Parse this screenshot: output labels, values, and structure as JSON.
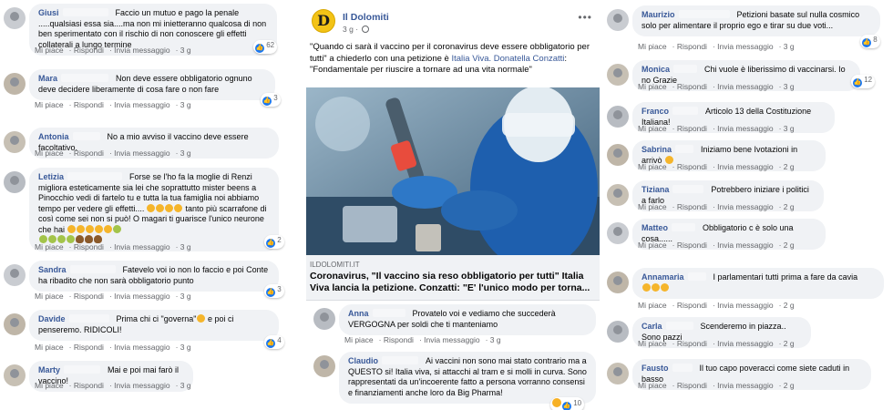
{
  "left": {
    "comments": [
      {
        "name": "Giusi",
        "text": "Faccio un mutuo e pago la penale .....qualsiasi essa sia....ma non mi inietteranno qualcosa di non ben sperimentato con il rischio di non conoscere gli effetti collaterali a lungo termine",
        "likes": "62"
      },
      {
        "name": "Mara",
        "text": "Non deve essere obbligatorio ognuno deve decidere liberamente di cosa fare o non fare",
        "likes": "3"
      },
      {
        "name": "Antonia",
        "text": "No a mio avviso il vaccino deve essere facoltativo."
      },
      {
        "name": "Letizia",
        "text": "Forse se l'ho fa la moglie di Renzi migliora esteticamente sia lei che soprattutto mister beens a Pinocchio vedi di fartelo tu e tutta la tua famiglia noi abbiamo tempo per vedere gli effetti....",
        "text2": "tanto più scarrafone di così come sei non si può! O magari ti guarisce l'unico neurone che hai",
        "likes": "2"
      },
      {
        "name": "Sandra",
        "text": "Fatevelo voi io non lo faccio e poi Conte ha ribadito che non sarà obbligatorio punto",
        "likes": "3"
      },
      {
        "name": "Davide",
        "text": "Prima chi ci \"governa\"",
        "text2": "e poi ci penseremo. RIDICOLI!",
        "likes": "4"
      },
      {
        "name": "Marty",
        "text": "Mai e poi mai farò il vaccino!"
      }
    ]
  },
  "actions": {
    "like": "Mi piace",
    "reply": "Rispondi",
    "message": "Invia messaggio",
    "time": "3 g",
    "time2": "2 g"
  },
  "post": {
    "page_name": "Il Dolomiti",
    "logo_letter": "D",
    "time": "3 g",
    "text_before": "\"Quando ci sarà il vaccino per il coronavirus deve essere obbligatorio per tutti\" a chiederlo con una petizione è ",
    "text_link": "Italia Viva. Donatella Conzatti",
    "text_after": ": \"Fondamentale per riuscire a tornare ad una vita normale\"",
    "link_domain": "ILDOLOMITI.IT",
    "link_title": "Coronavirus, \"Il vaccino sia reso obbligatorio per tutti\" Italia Viva lancia la petizione. Conzatti: \"E' l'unico modo per torna..."
  },
  "middle": {
    "comments": [
      {
        "name": "Anna",
        "text": "Provatelo voi e vediamo che succederà VERGOGNA per soldi che ti manteniamo"
      },
      {
        "name": "Claudio",
        "text": "Ai vaccini non sono mai stato contrario ma a QUESTO si! Italia viva, si attacchi al tram e si molli in curva. Sono rappresentati da un'incoerente fatto a persona vorranno consensi e finanziamenti anche loro da Big Pharma!",
        "likes": "10"
      }
    ]
  },
  "right": {
    "comments": [
      {
        "name": "Maurizio",
        "text": "Petizioni basate sul nulla cosmico solo per alimentare il proprio ego e tirar su due voti...",
        "likes": "8"
      },
      {
        "name": "Monica",
        "text": "Chi vuole è liberissimo di vaccinarsi. Io no Grazie",
        "likes": "12"
      },
      {
        "name": "Franco",
        "text": "Articolo 13 della Costituzione Italiana!"
      },
      {
        "name": "Sabrina",
        "text": "Iniziamo bene Ivotazioni in arrivò"
      },
      {
        "name": "Tiziana",
        "text": "Potrebbero iniziare i politici a farlo"
      },
      {
        "name": "Matteo",
        "text": "Obbligatorio c è solo una cosa......"
      },
      {
        "name": "Annamaria",
        "text": "I parlamentari tutti prima a fare da cavia"
      },
      {
        "name": "Carla",
        "text": "Scenderemo in piazza.. Sono pazzi"
      },
      {
        "name": "Fausto",
        "text": "Il tuo capo poveracci come siete caduti in basso"
      }
    ]
  }
}
